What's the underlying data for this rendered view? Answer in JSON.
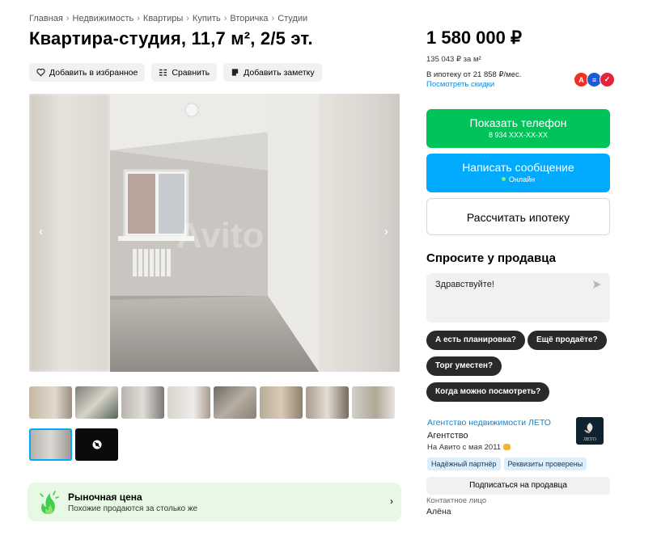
{
  "breadcrumbs": [
    "Главная",
    "Недвижимость",
    "Квартиры",
    "Купить",
    "Вторичка",
    "Студии"
  ],
  "breadcrumb_separator": "›",
  "title": "Квартира-студия, 11,7 м², 2/5 эт.",
  "actions": {
    "favorite": "Добавить в избранное",
    "compare": "Сравнить",
    "note": "Добавить заметку"
  },
  "gallery": {
    "watermark": "Avito",
    "prev_icon": "chevron-left-icon",
    "next_icon": "chevron-right-icon",
    "arrow_prev": "‹",
    "arrow_next": "›",
    "thumbnail_count": 10,
    "selected_thumbnail": 9
  },
  "market_price": {
    "title": "Рыночная цена",
    "subtitle": "Похожие продаются за столько же",
    "chevron": "›",
    "accent": "#e7f8e4"
  },
  "price": {
    "amount": "1 580 000 ₽",
    "per_meter": "135 043 ₽ за м²",
    "mortgage": "В ипотеку от 21 858 ₽/мес.",
    "discounts_link": "Посмотреть скидки",
    "bank_labels": [
      "А",
      "≡",
      "✓"
    ]
  },
  "buttons": {
    "show_phone": "Показать телефон",
    "phone_mask": "8 934 XXX-XX-XX",
    "write_message": "Написать сообщение",
    "online_status": "Онлайн",
    "calc_mortgage": "Рассчитать ипотеку",
    "phone_color": "#00c45a",
    "message_color": "#00aaff"
  },
  "ask_seller": {
    "heading": "Спросите у продавца",
    "message": "Здравствуйте!",
    "quick_questions": [
      "А есть планировка?",
      "Ещё продаёте?",
      "Торг уместен?",
      "Когда можно посмотреть?"
    ]
  },
  "seller": {
    "agency_name": "Агентство недвижимости ЛЕТО",
    "type": "Агентство",
    "since": "На Авито с мая 2011",
    "logo_text": "ЛЕТО",
    "badges": [
      "Надёжный партнёр",
      "Реквизиты проверены"
    ],
    "subscribe": "Подписаться на продавца",
    "contact_label": "Контактное лицо",
    "contact_name": "Алёна"
  }
}
